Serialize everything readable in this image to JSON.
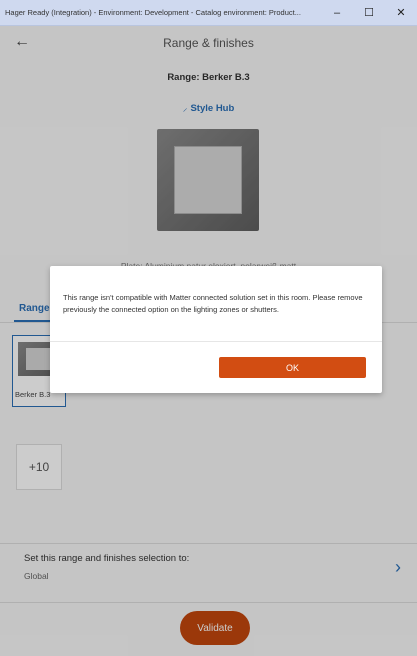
{
  "window": {
    "title": "Hager Ready (Integration) - Environment: Development - Catalog environment: Product..."
  },
  "header": {
    "title": "Range & finishes"
  },
  "range": {
    "label": "Range: Berker B.3",
    "style_hub": "Style Hub",
    "plate_text": "Plate: Aluminium natur eloxiert, polarweiß matt"
  },
  "tabs": {
    "range": "Range"
  },
  "thumbnails": {
    "selected_label": "Berker B.3",
    "more": "+10"
  },
  "selection": {
    "title": "Set this range and finishes selection to:",
    "value": "Global"
  },
  "footer": {
    "validate": "Validate"
  },
  "dialog": {
    "message": "This range isn't compatible with Matter connected solution set in this room. Please remove previously the connected option on the lighting zones or shutters.",
    "ok": "OK"
  },
  "colors": {
    "accent_blue": "#2a6fb6",
    "primary_orange": "#d24d12"
  }
}
